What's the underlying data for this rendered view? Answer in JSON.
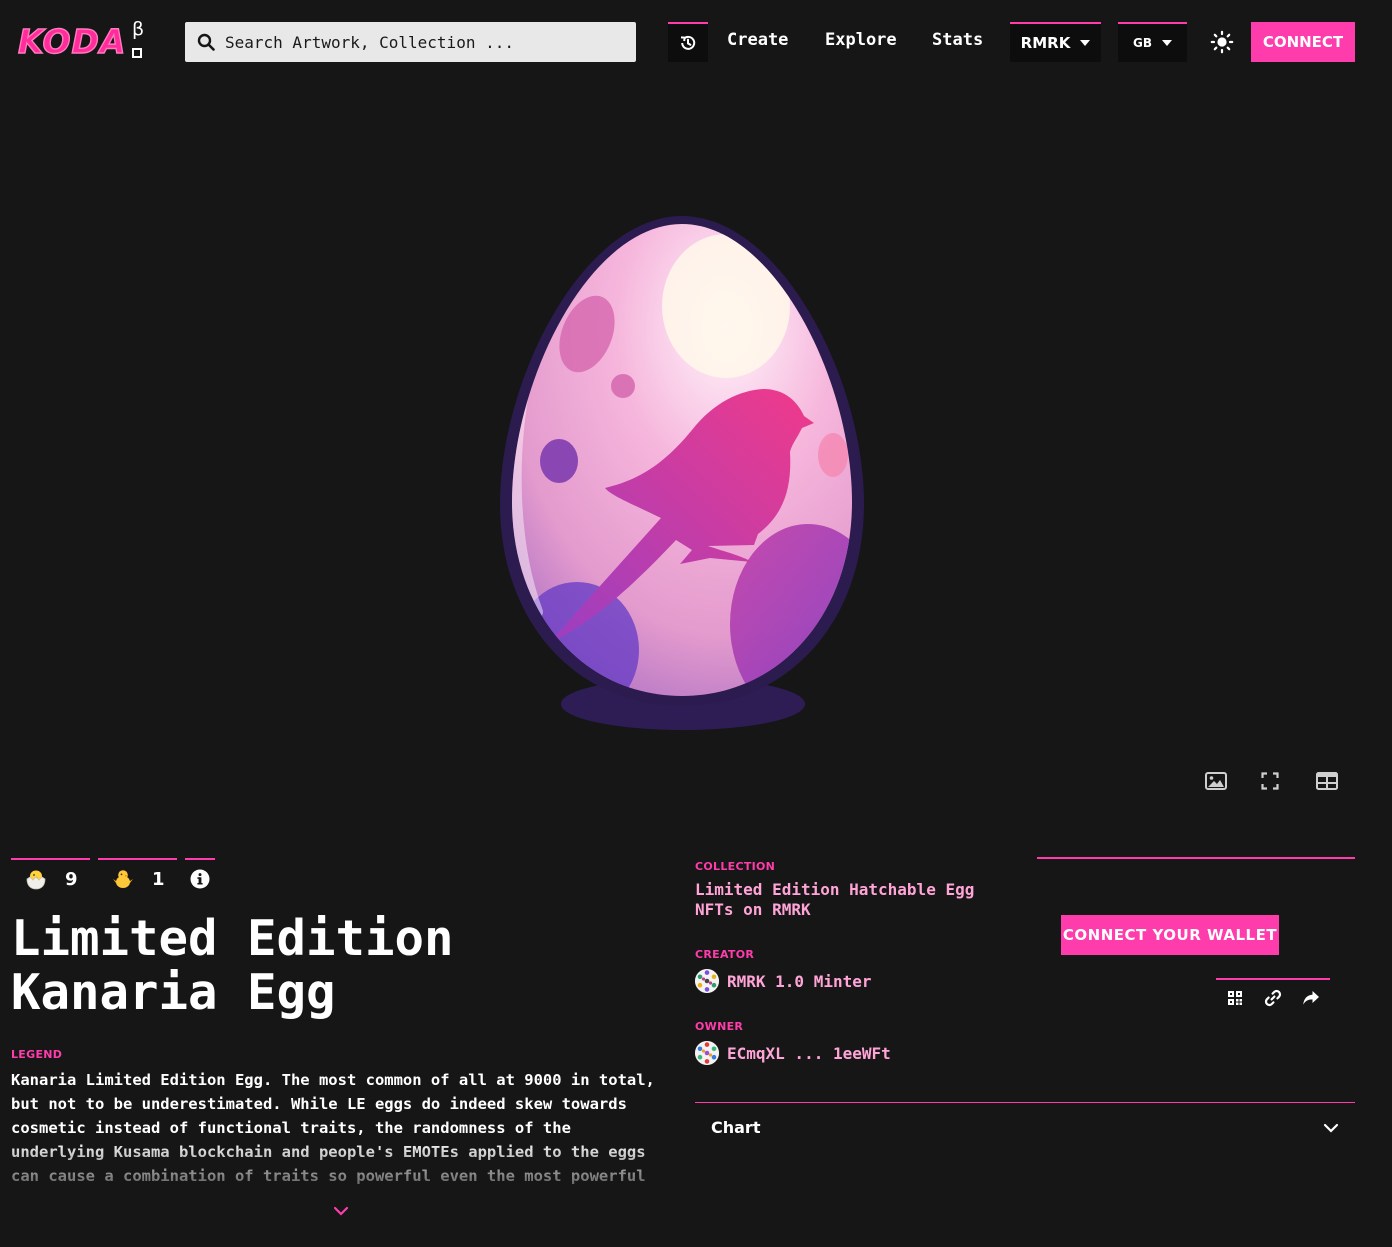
{
  "header": {
    "logo_text": "KODA",
    "logo_beta": "β",
    "search_placeholder": "Search Artwork, Collection ...",
    "nav": {
      "create": "Create",
      "explore": "Explore",
      "stats": "Stats"
    },
    "chain_select": "RMRK",
    "language_select": "GB",
    "connect_label": "CONNECT"
  },
  "colors": {
    "accent": "#ff3cab",
    "accent_light": "#ffa4d6",
    "background": "#161616"
  },
  "media": {
    "tools": [
      "image-icon",
      "fullscreen-icon",
      "gallery-icon"
    ]
  },
  "badges": [
    {
      "icon": "hatching-chick-icon",
      "count": "9"
    },
    {
      "icon": "baby-chick-icon",
      "count": "1"
    }
  ],
  "item": {
    "title": "Limited Edition Kanaria Egg",
    "description_label": "LEGEND",
    "description": "Kanaria Limited Edition Egg. The most common of all at 9000 in total, but not to be underestimated. While LE eggs do indeed skew towards cosmetic instead of functional traits, the randomness of the underlying Kusama blockchain and people's EMOTEs applied to the eggs can cause a combination of traits so powerful even the most powerful"
  },
  "collection": {
    "label": "COLLECTION",
    "name": "Limited Edition Hatchable Egg NFTs on RMRK"
  },
  "creator": {
    "label": "CREATOR",
    "name": "RMRK 1.0 Minter"
  },
  "owner": {
    "label": "OWNER",
    "name": "ECmqXL ... 1eeWFt"
  },
  "actions": {
    "connect_wallet_label": "CONNECT YOUR WALLET",
    "share_icons": [
      "qr-code-icon",
      "link-icon",
      "share-icon"
    ]
  },
  "chart": {
    "label": "Chart"
  }
}
